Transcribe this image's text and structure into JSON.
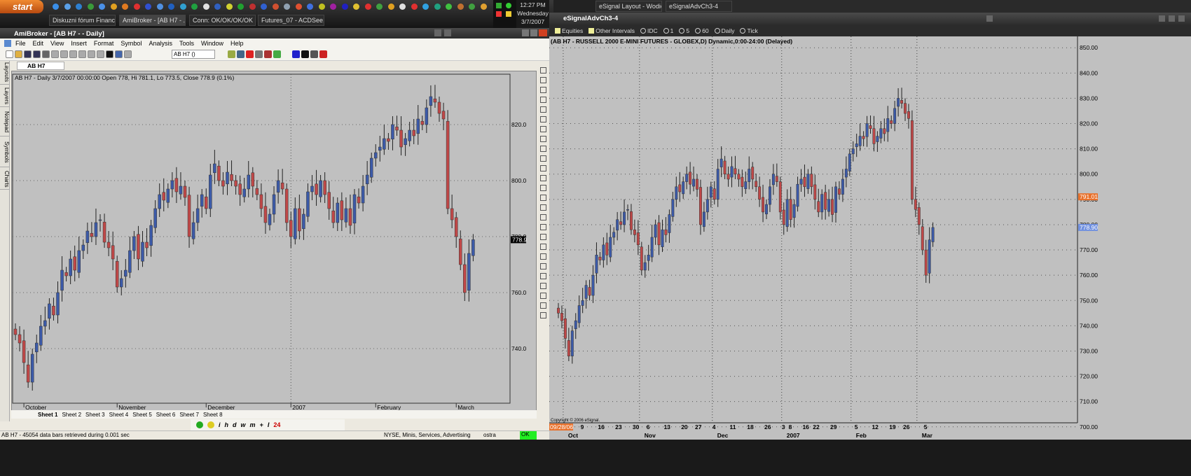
{
  "taskbar": {
    "start": "start",
    "tabs": [
      "Diskuzni fórum Financ...",
      "AmiBroker - [AB H7 - ...",
      "Conn: OK/OK/OK/OK",
      "Futures_07 - ACDSee..."
    ],
    "clock": {
      "time": "12:27 PM",
      "day": "Wednesday",
      "date": "3/7/2007"
    },
    "right_tabs": [
      "eSignal Layout - Wodie",
      "eSignalAdvCh3-4"
    ],
    "quicklaunch_colors": [
      "#3a8ee8",
      "#5aa0e8",
      "#2d7fd0",
      "#3a9a3a",
      "#4a90e8",
      "#e0a020",
      "#e07a20",
      "#e03030",
      "#3050d0",
      "#5090e0",
      "#2060c0",
      "#30a0d0",
      "#20a040",
      "#e0e0e0",
      "#3060c0",
      "#d0d030",
      "#20a030",
      "#c03030",
      "#3060d0",
      "#d05030",
      "#90a0b0",
      "#e05030",
      "#4070e0",
      "#c0c020",
      "#a020a0",
      "#2020c0",
      "#e0c030",
      "#e03030",
      "#40a040",
      "#e0a020",
      "#e0e0e0",
      "#e03030",
      "#30a0e0",
      "#20a080",
      "#40c040",
      "#c07030",
      "#40a040",
      "#e0a030"
    ]
  },
  "amibroker": {
    "title": "AmiBroker - [AB H7 -  - Daily]",
    "menu": [
      "File",
      "Edit",
      "View",
      "Insert",
      "Format",
      "Symbol",
      "Analysis",
      "Tools",
      "Window",
      "Help"
    ],
    "symbol_select": "AB H7 ()",
    "chart_tab": "AB H7 (Daily)",
    "side_tabs": [
      "Layouts",
      "Layers",
      "Notepad",
      "Symbols",
      "Charts"
    ],
    "chart_header": "AB H7 - Daily 3/7/2007 00:00:00 Open 778, Hi 781.1, Lo 773.5, Close 778.9 (0.1%)",
    "last_price_label": "778.9",
    "sheets": [
      "Sheet 1",
      "Sheet 2",
      "Sheet 3",
      "Sheet 4",
      "Sheet 5",
      "Sheet 6",
      "Sheet 7",
      "Sheet 8"
    ],
    "bottom_toolbar": [
      "i",
      "h",
      "d",
      "w",
      "m",
      "+",
      "I",
      "24"
    ],
    "status": {
      "message": "AB H7 - 45054 data bars retrieved during 0.001 sec",
      "categories": "NYSE, Minis, Services, Advertising",
      "user": "ostra",
      "state": "OK"
    }
  },
  "esignal": {
    "title": "eSignalAdvCh3-4",
    "toolbar": [
      "Equities",
      "Other Intervals",
      "IDC",
      "1",
      "5",
      "60",
      "Daily",
      "Tick"
    ],
    "chart_header": "(AB H7 - RUSSELL 2000 E-MINI FUTURES - GLOBEX,D) Dynamic,0:00-24:00 (Delayed)",
    "copyright": "Copyright © 2006 eSignal.",
    "price_tags": {
      "high": "791.01",
      "last": "778.90"
    },
    "start_date": "09/28/06",
    "day_ticks": [
      "9",
      "16",
      "23",
      "30",
      "6",
      "13",
      "20",
      "27",
      "4",
      "11",
      "18",
      "26",
      "3",
      "8",
      "16",
      "22",
      "29",
      "5",
      "12",
      "19",
      "26",
      "5"
    ],
    "month_labels": [
      "Oct",
      "Nov",
      "Dec",
      "2007",
      "Feb",
      "Mar"
    ]
  },
  "chart_data": {
    "type": "candlestick",
    "title": "AB H7 Daily (Russell 2000 E-mini futures)",
    "colors": {
      "up": "#3c5aa8",
      "down": "#c04848"
    },
    "left_axis": {
      "ticks": [
        740,
        760,
        780,
        800,
        820
      ],
      "ylim": [
        721,
        838
      ],
      "months": [
        "October",
        "November",
        "December",
        "2007",
        "February",
        "March"
      ]
    },
    "right_axis": {
      "ticks": [
        700,
        710,
        720,
        730,
        740,
        750,
        760,
        770,
        780,
        790,
        800,
        810,
        820,
        830,
        840,
        850
      ],
      "ylim": [
        698,
        852
      ]
    },
    "month_start_index": {
      "October": 2,
      "November": 24,
      "December": 45,
      "2007": 65,
      "February": 85,
      "March": 104
    },
    "day_tick_index": [
      7,
      12,
      17,
      22,
      26,
      31,
      36,
      40,
      45,
      50,
      55,
      60,
      65,
      67,
      71,
      74,
      79,
      86,
      91,
      96,
      100,
      106
    ],
    "close": [
      745,
      742,
      735,
      728,
      738,
      742,
      748,
      750,
      756,
      752,
      760,
      768,
      766,
      772,
      768,
      775,
      777,
      782,
      780,
      785,
      786,
      778,
      776,
      772,
      762,
      765,
      768,
      775,
      780,
      772,
      778,
      776,
      784,
      790,
      795,
      793,
      797,
      800,
      796,
      798,
      794,
      780,
      785,
      790,
      795,
      790,
      802,
      806,
      800,
      798,
      803,
      800,
      798,
      795,
      797,
      802,
      798,
      795,
      790,
      785,
      788,
      795,
      800,
      797,
      785,
      780,
      790,
      782,
      788,
      796,
      798,
      795,
      800,
      795,
      790,
      785,
      792,
      786,
      790,
      784,
      795,
      792,
      798,
      802,
      808,
      810,
      812,
      815,
      814,
      820,
      818,
      812,
      815,
      818,
      816,
      822,
      820,
      826,
      830,
      828,
      824,
      822,
      790,
      786,
      780,
      770,
      760,
      774,
      778.9
    ]
  }
}
